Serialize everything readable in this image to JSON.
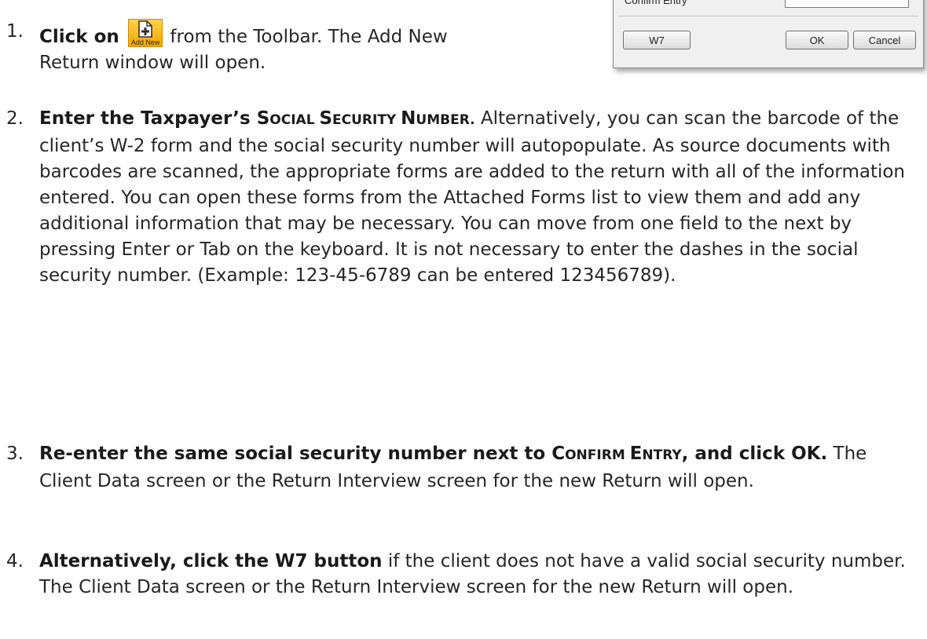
{
  "dialog": {
    "confirm_label": "Confirm Entry",
    "buttons": {
      "w7": "W7",
      "ok": "OK",
      "cancel": "Cancel"
    }
  },
  "toolbar_icon": {
    "label": "Add New",
    "icon": "add-document-icon",
    "color": "#f7b500"
  },
  "steps": [
    {
      "num": "1.",
      "bold": "Click on",
      "rest_line1": "from the Toolbar.  The Add New",
      "rest_line2": "Return window will open."
    },
    {
      "num": "2.",
      "bold_a": "Enter the Taxpayer’s ",
      "bold_sc1_first": "S",
      "bold_sc1_rest": "OCIAL ",
      "bold_sc2_first": "S",
      "bold_sc2_rest": "ECURITY ",
      "bold_sc3_first": "N",
      "bold_sc3_rest": "UMBER.",
      "text": " Alternatively, you can scan the barcode of the client’s W-2 form and the social security number will autopopulate. As source documents with barcodes are scanned, the appropriate forms are added to the return with all of the information entered. You can open these forms from the Attached Forms list to view them and add any additional information that may be necessary. You can move from one field to the next by pressing Enter or Tab on the keyboard. It is not necessary to enter the dashes in the social security number. (Example: 123-45-6789 can be entered 123456789)."
    },
    {
      "num": "3.",
      "bold_a": "Re-enter the same social security number next to ",
      "bold_sc1_first": "C",
      "bold_sc1_rest": "ONFIRM ",
      "bold_sc2_first": "E",
      "bold_sc2_rest": "NTRY",
      "bold_b": ", and click OK.",
      "text": " The Client Data screen or the Return Interview screen for the new Return will open."
    },
    {
      "num": "4.",
      "bold": "Alternatively, click the W7 button",
      "text": " if the client does not have a valid social security number. The Client Data screen or the Return Interview screen for the new Return will open."
    }
  ]
}
